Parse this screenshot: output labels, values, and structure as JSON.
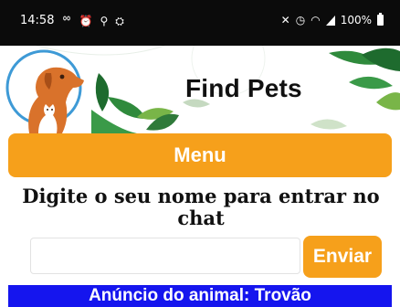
{
  "status_bar": {
    "time": "14:58",
    "left_icons": [
      "voicemail-icon",
      "alarm-icon",
      "usb-icon",
      "incognito-icon"
    ],
    "right_icons": [
      "mute-icon",
      "alarm-icon",
      "wifi-icon",
      "signal-icon"
    ],
    "battery": "100%"
  },
  "header": {
    "title": "Find Pets",
    "logo_icon": "dog-cat-logo-icon"
  },
  "menu": {
    "label": "Menu"
  },
  "chat": {
    "prompt": "Digite o seu nome para entrar no chat",
    "name_value": "",
    "send_label": "Enviar"
  },
  "ad": {
    "title": "Anúncio do animal: Trovão"
  },
  "colors": {
    "accent": "#f6a01b",
    "banner": "#1515ee",
    "status_bar": "#0b0b0b"
  }
}
